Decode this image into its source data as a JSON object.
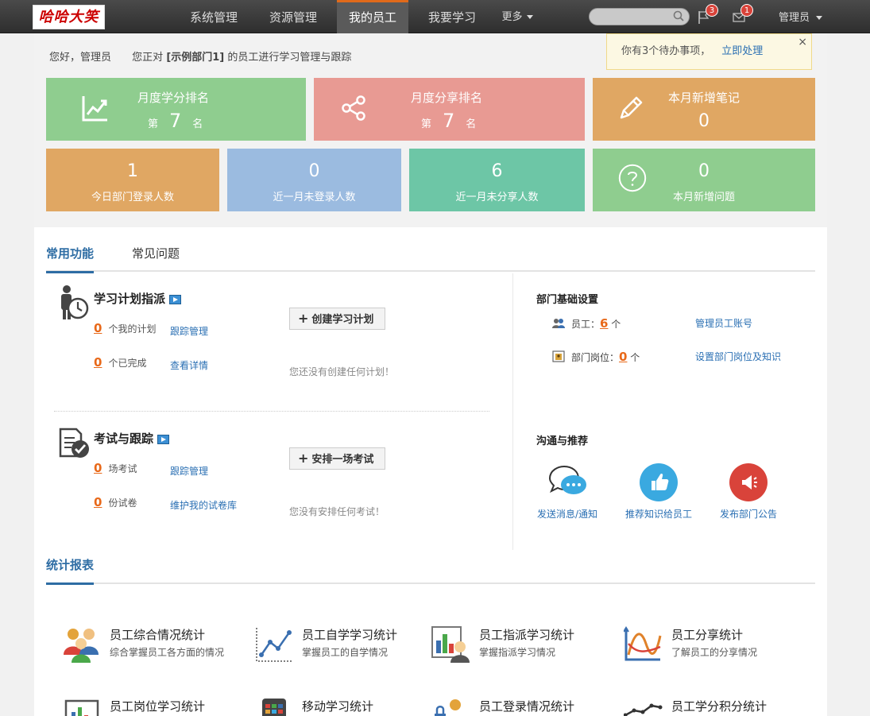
{
  "nav": {
    "logo": "哈哈大笑",
    "items": [
      "系统管理",
      "资源管理",
      "我的员工",
      "我要学习"
    ],
    "more": "更多",
    "search_placeholder": "",
    "flag_badge": "3",
    "mail_badge": "1",
    "user": "管理员"
  },
  "greeting": {
    "hello": "您好，管理员",
    "prefix": "您正对",
    "dept": "[示例部门1]",
    "suffix": "的员工进行学习管理与跟踪"
  },
  "notice": {
    "text": "你有3个待办事项，",
    "link": "立即处理",
    "close": "×"
  },
  "tiles": {
    "study_rank": {
      "title": "月度学分排名",
      "pre": "第",
      "value": "7",
      "post": "名",
      "color": "#8fcd8f"
    },
    "share_rank": {
      "title": "月度分享排名",
      "pre": "第",
      "value": "7",
      "post": "名",
      "color": "#e89a93"
    },
    "new_notes": {
      "title": "本月新增笔记",
      "value": "0",
      "color": "#e0a763"
    },
    "login_today": {
      "value": "1",
      "label": "今日部门登录人数",
      "color": "#e0a763"
    },
    "no_login": {
      "value": "0",
      "label": "近一月未登录人数",
      "color": "#9bbbe0"
    },
    "no_share": {
      "value": "6",
      "label": "近一月未分享人数",
      "color": "#6dc6a6"
    },
    "new_questions": {
      "value": "0",
      "label": "本月新增问题",
      "color": "#8fcd8f"
    }
  },
  "tabs": [
    "常用功能",
    "常见问题"
  ],
  "plan": {
    "title": "学习计划指派",
    "my_plans_count": "0",
    "my_plans_label": "个我的计划",
    "my_plans_link": "跟踪管理",
    "done_count": "0",
    "done_label": "个已完成",
    "done_link": "查看详情",
    "button": "创建学习计划",
    "empty": "您还没有创建任何计划！"
  },
  "exam": {
    "title": "考试与跟踪",
    "exam_count": "0",
    "exam_label": "场考试",
    "exam_link": "跟踪管理",
    "paper_count": "0",
    "paper_label": "份试卷",
    "paper_link": "维护我的试卷库",
    "button": "安排一场考试",
    "empty": "您没有安排任何考试！"
  },
  "dept": {
    "title": "部门基础设置",
    "staff_label": "员工：",
    "staff_count": "6",
    "staff_unit": "个",
    "staff_link": "管理员工账号",
    "post_label": "部门岗位：",
    "post_count": "0",
    "post_unit": "个",
    "post_link": "设置部门岗位及知识"
  },
  "comm": {
    "title": "沟通与推荐",
    "items": [
      "发送消息/通知",
      "推荐知识给员工",
      "发布部门公告"
    ],
    "colors": [
      "#ffffff",
      "#3aa9e0",
      "#d9433a"
    ]
  },
  "reports": {
    "tab": "统计报表",
    "items": [
      {
        "title": "员工综合情况统计",
        "desc": "综合掌握员工各方面的情况"
      },
      {
        "title": "员工自学学习统计",
        "desc": "掌握员工的自学情况"
      },
      {
        "title": "员工指派学习统计",
        "desc": "掌握指派学习情况"
      },
      {
        "title": "员工分享统计",
        "desc": "了解员工的分享情况"
      },
      {
        "title": "员工岗位学习统计",
        "desc": ""
      },
      {
        "title": "移动学习统计",
        "desc": ""
      },
      {
        "title": "员工登录情况统计",
        "desc": ""
      },
      {
        "title": "员工学分积分统计",
        "desc": ""
      }
    ]
  }
}
